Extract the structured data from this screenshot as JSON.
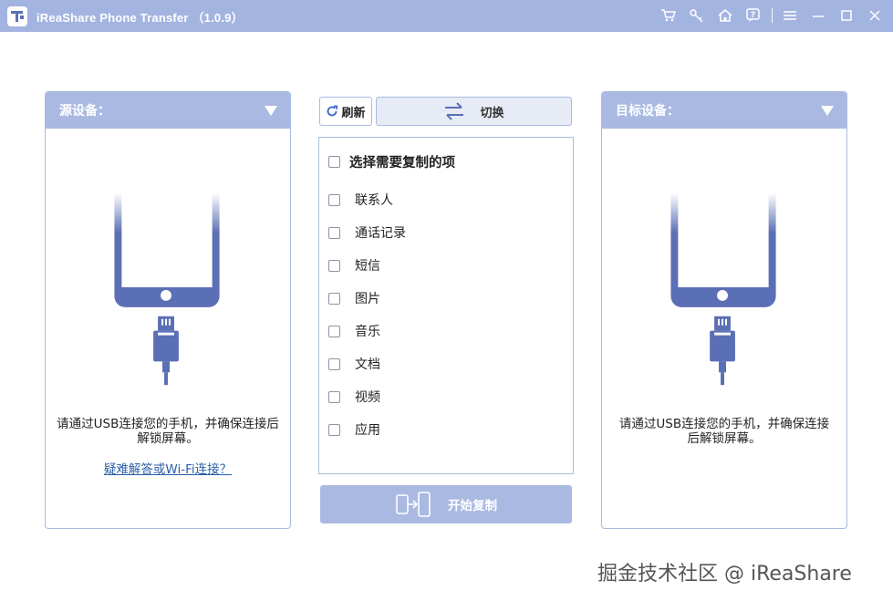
{
  "titlebar": {
    "title": "iReaShare Phone Transfer （1.0.9）",
    "icons": [
      "cart-icon",
      "key-icon",
      "home-icon",
      "help-icon",
      "menu-icon",
      "minimize-icon",
      "maximize-icon",
      "close-icon"
    ]
  },
  "source_panel": {
    "title": "源设备：",
    "message": "请通过USB连接您的手机，并确保连接后解锁屏幕。",
    "help_link": "疑难解答或Wi-Fi连接？"
  },
  "target_panel": {
    "title": "目标设备：",
    "message": "请通过USB连接您的手机，并确保连接后解锁屏幕。"
  },
  "toolbar": {
    "refresh_label": "刷新",
    "switch_label": "切换"
  },
  "items": {
    "select_all_label": "选择需要复制的项",
    "list": [
      "联系人",
      "通话记录",
      "短信",
      "图片",
      "音乐",
      "文档",
      "视频",
      "应用"
    ]
  },
  "start_button": {
    "label": "开始复制"
  },
  "watermark": "掘金技术社区 @ iReaShare",
  "colors": {
    "accent": "#a9b9e2",
    "phone": "#5a6fb5",
    "link": "#2a5ea8"
  }
}
